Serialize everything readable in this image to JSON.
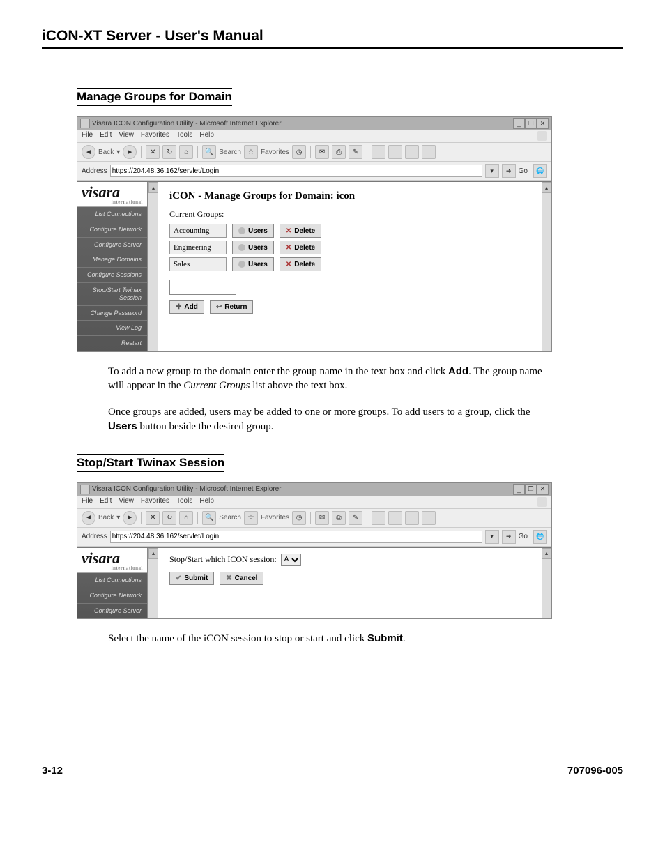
{
  "page_header": "iCON-XT Server - User's Manual",
  "section1_title": "Manage Groups for Domain",
  "section2_title": "Stop/Start Twinax Session",
  "browser": {
    "title": "Visara ICON Configuration Utility - Microsoft Internet Explorer",
    "menu": {
      "file": "File",
      "edit": "Edit",
      "view": "View",
      "favorites": "Favorites",
      "tools": "Tools",
      "help": "Help"
    },
    "toolbar": {
      "back": "Back",
      "search": "Search",
      "favorites": "Favorites"
    },
    "address_label": "Address",
    "address_url": "https://204.48.36.162/servlet/Login",
    "go": "Go"
  },
  "sidebar": {
    "brand": "visara",
    "brand_sub": "international",
    "items": {
      "0": "List Connections",
      "1": "Configure Network",
      "2": "Configure Server",
      "3": "Manage Domains",
      "4": "Configure Sessions",
      "5": "Stop/Start Twinax Session",
      "6": "Change Password",
      "7": "View Log",
      "8": "Restart"
    }
  },
  "groups_page": {
    "title": "iCON - Manage Groups for Domain: icon",
    "current_label": "Current Groups:",
    "rows": {
      "0": "Accounting",
      "1": "Engineering",
      "2": "Sales"
    },
    "users_btn": "Users",
    "delete_btn": "Delete",
    "add_btn": "Add",
    "return_btn": "Return"
  },
  "twinax_page": {
    "label": "Stop/Start which ICON session:",
    "selected": "A",
    "submit_btn": "Submit",
    "cancel_btn": "Cancel"
  },
  "para1_a": "To add a new group to the domain enter the group name in the text box and click ",
  "para1_add": "Add",
  "para1_b": ". The group name will appear in the ",
  "para1_cg": "Current Groups",
  "para1_c": " list above the text box.",
  "para2_a": "Once groups are added, users may be added to one or more groups. To add users to a group, click the ",
  "para2_users": "Users",
  "para2_b": " button beside the desired group.",
  "para3_a": "Select the name of the iCON session to stop or start and click ",
  "para3_submit": "Submit",
  "para3_b": ".",
  "footer_left": "3-12",
  "footer_right": "707096-005"
}
